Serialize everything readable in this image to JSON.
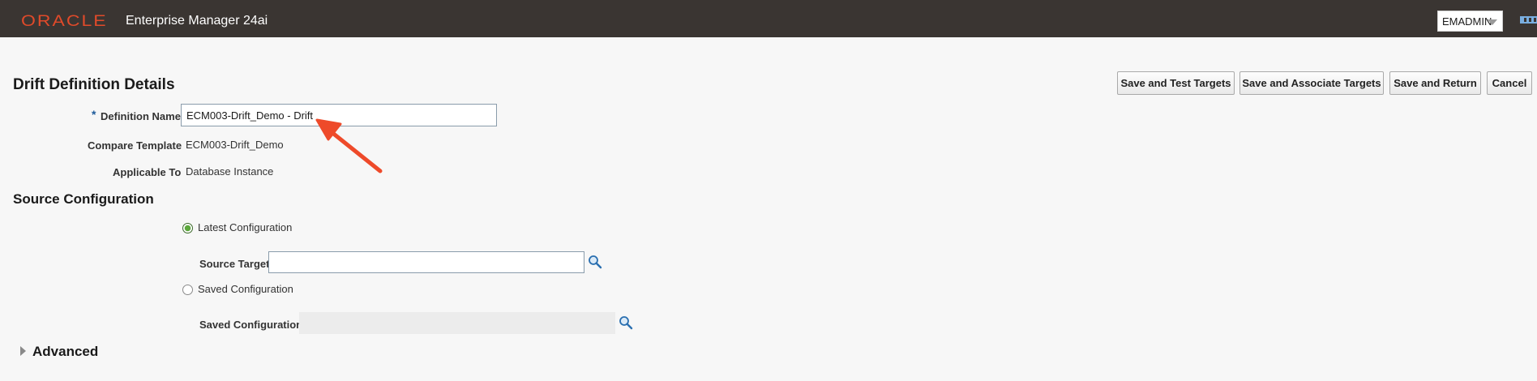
{
  "header": {
    "logo_text": "ORACLE",
    "app_title": "Enterprise Manager 24ai",
    "user": "EMADMIN"
  },
  "page": {
    "title": "Drift Definition Details"
  },
  "actions": {
    "save_test": "Save and Test Targets",
    "save_associate": "Save and Associate Targets",
    "save_return": "Save and Return",
    "cancel": "Cancel"
  },
  "form": {
    "required_marker": "*",
    "definition_name_label": "Definition Name",
    "definition_name_value": "ECM003-Drift_Demo - Drift",
    "compare_template_label": "Compare Template",
    "compare_template_value": "ECM003-Drift_Demo",
    "applicable_to_label": "Applicable To",
    "applicable_to_value": "Database Instance"
  },
  "source_configuration": {
    "title": "Source Configuration",
    "latest_label": "Latest Configuration",
    "latest_selected": true,
    "source_target_label": "Source Target",
    "source_target_value": "",
    "saved_label": "Saved Configuration",
    "saved_selected": false,
    "saved_config_label": "Saved Configuration",
    "saved_config_value": ""
  },
  "advanced": {
    "title": "Advanced",
    "expanded": false
  },
  "colors": {
    "header_bg": "#3a3532",
    "oracle_red": "#e04a2a",
    "annotation_arrow": "#ee4a2a",
    "radio_selected": "#5ca83c",
    "search_icon": "#2a6fb0"
  }
}
